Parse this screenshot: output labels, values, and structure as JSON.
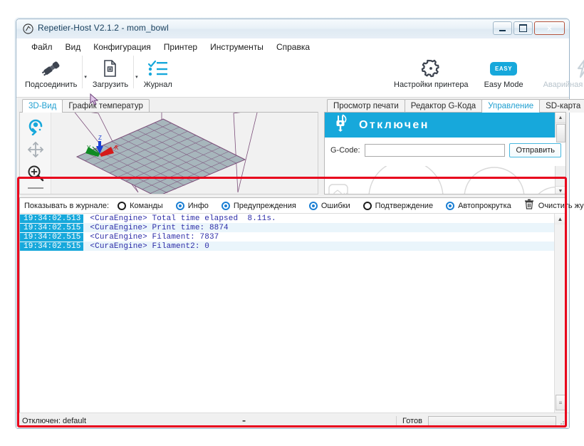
{
  "window": {
    "title": "Repetier-Host V2.1.2 - mom_bowl",
    "app_icon": "repetier-icon",
    "minimize_label": "",
    "maximize_label": "",
    "close_label": "×"
  },
  "menu": {
    "items": [
      {
        "label": "Файл",
        "name": "menu-file"
      },
      {
        "label": "Вид",
        "name": "menu-view"
      },
      {
        "label": "Конфигурация",
        "name": "menu-configuration"
      },
      {
        "label": "Принтер",
        "name": "menu-printer"
      },
      {
        "label": "Инструменты",
        "name": "menu-tools"
      },
      {
        "label": "Справка",
        "name": "menu-help"
      }
    ]
  },
  "toolbar": {
    "connect": {
      "label": "Подсоединить",
      "icon": "plug-connect-icon"
    },
    "load": {
      "label": "Загрузить",
      "icon": "file-add-icon"
    },
    "log": {
      "label": "Журнал",
      "icon": "checklist-icon"
    },
    "printer_settings": {
      "label": "Настройки принтера",
      "icon": "gear-icon"
    },
    "easy_mode": {
      "label": "Easy Mode",
      "icon": "easy-badge-icon",
      "badge_text": "EASY",
      "badge_color": "#17a8db"
    },
    "emergency_stop": {
      "label": "Аварийная остановка",
      "icon": "lightning-icon",
      "disabled": true
    },
    "dropdown_caret": "▾"
  },
  "left_pane": {
    "tabs": [
      {
        "label": "3D-Вид",
        "active": true
      },
      {
        "label": "График температур",
        "active": false
      }
    ],
    "view_tools": [
      {
        "name": "rotate-tool",
        "icon": "rotate-icon",
        "active": true
      },
      {
        "name": "move-tool",
        "icon": "move-arrows-icon",
        "active": false
      },
      {
        "name": "zoom-tool",
        "icon": "magnifier-plus-icon",
        "active": false
      }
    ]
  },
  "right_pane": {
    "tabs": [
      {
        "label": "Просмотр печати",
        "active": false
      },
      {
        "label": "Редактор G-Кода",
        "active": false
      },
      {
        "label": "Управление",
        "active": true
      },
      {
        "label": "SD-карта",
        "active": false
      }
    ],
    "tab_scroll_left": "◄",
    "tab_scroll_right": "►",
    "connection": {
      "status": "Отключен",
      "icon": "plug-disconnected-icon",
      "banner_color": "#17a8db"
    },
    "gcode": {
      "label": "G-Code:",
      "value": "",
      "placeholder": "",
      "send_label": "Отправить"
    }
  },
  "log": {
    "filter_caption": "Показывать в журнале:",
    "filters": [
      {
        "label": "Команды",
        "checked": false
      },
      {
        "label": "Инфо",
        "checked": true
      },
      {
        "label": "Предупреждения",
        "checked": true
      },
      {
        "label": "Ошибки",
        "checked": true
      },
      {
        "label": "Подтверждение",
        "checked": false
      },
      {
        "label": "Автопрокрутка",
        "checked": true
      }
    ],
    "clear_button": {
      "label": "Очистить журнал",
      "icon": "trash-icon"
    },
    "rows": [
      {
        "time": "19:34:02.513",
        "message": "<CuraEngine> Total time elapsed  8.11s."
      },
      {
        "time": "19:34:02.515",
        "message": "<CuraEngine> Print time: 8874"
      },
      {
        "time": "19:34:02.515",
        "message": "<CuraEngine> Filament: 7837"
      },
      {
        "time": "19:34:02.515",
        "message": "<CuraEngine> Filament2: 0"
      }
    ],
    "scroll_up": "▲",
    "scroll_down": "▼",
    "thumb_grip": "≡"
  },
  "statusbar": {
    "connection": "Отключен: default",
    "center": "-",
    "ready_label": "Готов",
    "progress_percent": 0
  },
  "colors": {
    "accent": "#17a8db",
    "highlight_box": "#e8001c",
    "log_text": "#2d2da8",
    "radio_on": "#1b7fd4"
  }
}
